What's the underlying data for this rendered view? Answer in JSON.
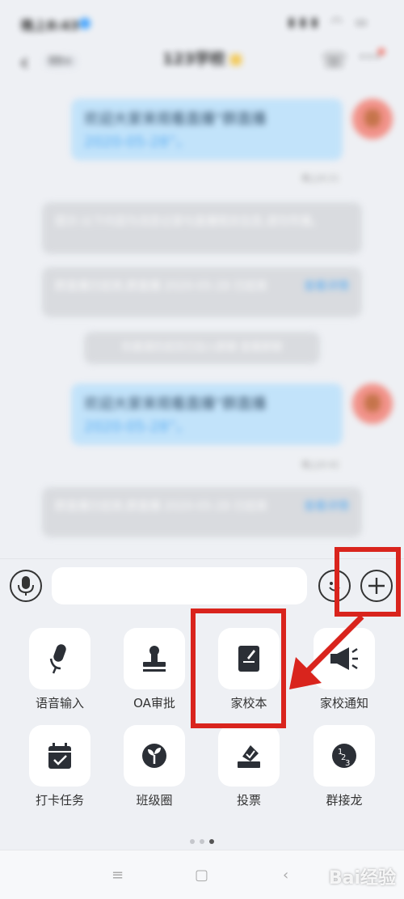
{
  "status_bar": {
    "time": "晚上8:43",
    "icons": "▮▮▮ ◠ ▭"
  },
  "header": {
    "back_count": "99+",
    "title": "123学校",
    "subtitle": ""
  },
  "messages": [
    {
      "type": "out",
      "line1": "欢迎大家来观看直播“群直播",
      "line2": "2020-05-28”。",
      "time": "晚上8:21"
    },
    {
      "type": "in",
      "text": "提示:以下内容为消息记录与直播相关信息,请勿传播。"
    },
    {
      "type": "in",
      "text": "群直播已结束,群直播 2020-05-28 已结束",
      "more": "查看详情"
    },
    {
      "type": "sys",
      "text": "你邀请的成员已加入群聊 查看群聊"
    },
    {
      "type": "out",
      "line1": "欢迎大家来观看直播“群直播",
      "line2": "2020-05-28”。",
      "time": "晚上8:42"
    },
    {
      "type": "in",
      "text": "群直播已结束,群直播 2020-05-28 已结束",
      "more": "查看详情"
    }
  ],
  "input": {
    "value": "",
    "placeholder": ""
  },
  "functions": [
    {
      "label": "语音输入",
      "icon": "mic-icon"
    },
    {
      "label": "OA审批",
      "icon": "stamp-icon"
    },
    {
      "label": "家校本",
      "icon": "notebook-icon"
    },
    {
      "label": "家校通知",
      "icon": "megaphone-icon"
    },
    {
      "label": "打卡任务",
      "icon": "calendar-check-icon"
    },
    {
      "label": "班级圈",
      "icon": "sprout-icon"
    },
    {
      "label": "投票",
      "icon": "ballot-icon"
    },
    {
      "label": "群接龙",
      "icon": "relay-icon"
    }
  ],
  "pager": {
    "pages": 3,
    "active": 3
  },
  "watermark": "Bai经验",
  "colors": {
    "highlight": "#d9241d",
    "bubble_out": "#bfe2fb",
    "link": "#4aa6f2"
  }
}
